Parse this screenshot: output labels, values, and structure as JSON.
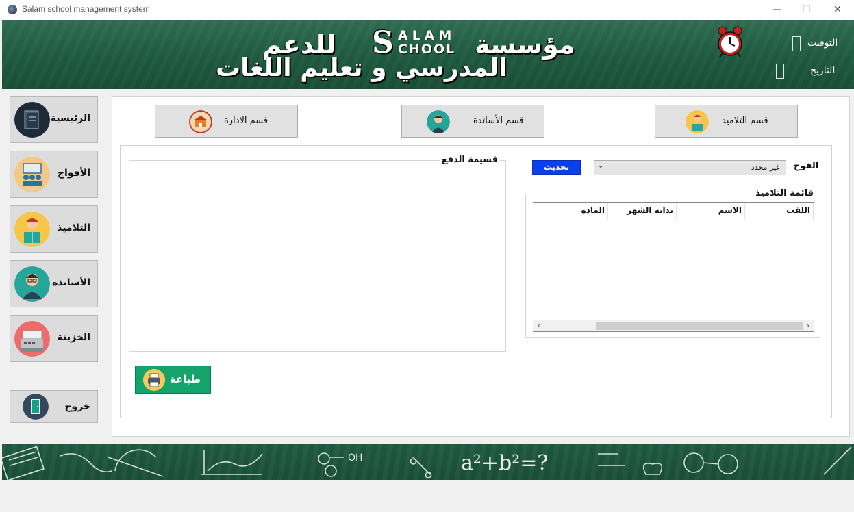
{
  "window": {
    "title": "Salam school management system",
    "minimize": "—",
    "maximize": "☐",
    "close": "✕"
  },
  "header": {
    "brand_letter": "S",
    "brand_top": "ALAM",
    "brand_bottom": "CHOOL",
    "line1_right": "مؤسسة",
    "line1_left": "للدعم",
    "line2": "المدرسي و تعليم اللغات",
    "time_label": "التوقيت",
    "date_label": "التاريخ"
  },
  "sidebar": {
    "items": [
      {
        "label": "الرئيسية",
        "icon": "logo-book-icon"
      },
      {
        "label": "الأفواج",
        "icon": "group-icon"
      },
      {
        "label": "التلاميذ",
        "icon": "student-icon"
      },
      {
        "label": "الأساتذة",
        "icon": "teacher-icon"
      },
      {
        "label": "الخزينة",
        "icon": "cash-register-icon"
      }
    ],
    "exit_label": "خروج"
  },
  "sections": {
    "admin": "قسم الادارة",
    "teachers": "قسم الأساتذة",
    "students": "قسم التلاميذ"
  },
  "panel": {
    "payment_slip_title": "قسيمة الدفع",
    "group_label": "الفوج",
    "group_select_value": "غير محدد",
    "refresh_label": "تحديث",
    "students_list_title": "قائمة التلاميذ",
    "columns": [
      "اللقب",
      "الاسم",
      "بداية الشهر",
      "المادة"
    ],
    "print_label": "طباعة"
  },
  "colors": {
    "banner_green": "#1f5a40",
    "refresh_blue": "#0a3ff0",
    "print_green": "#14a36a"
  }
}
